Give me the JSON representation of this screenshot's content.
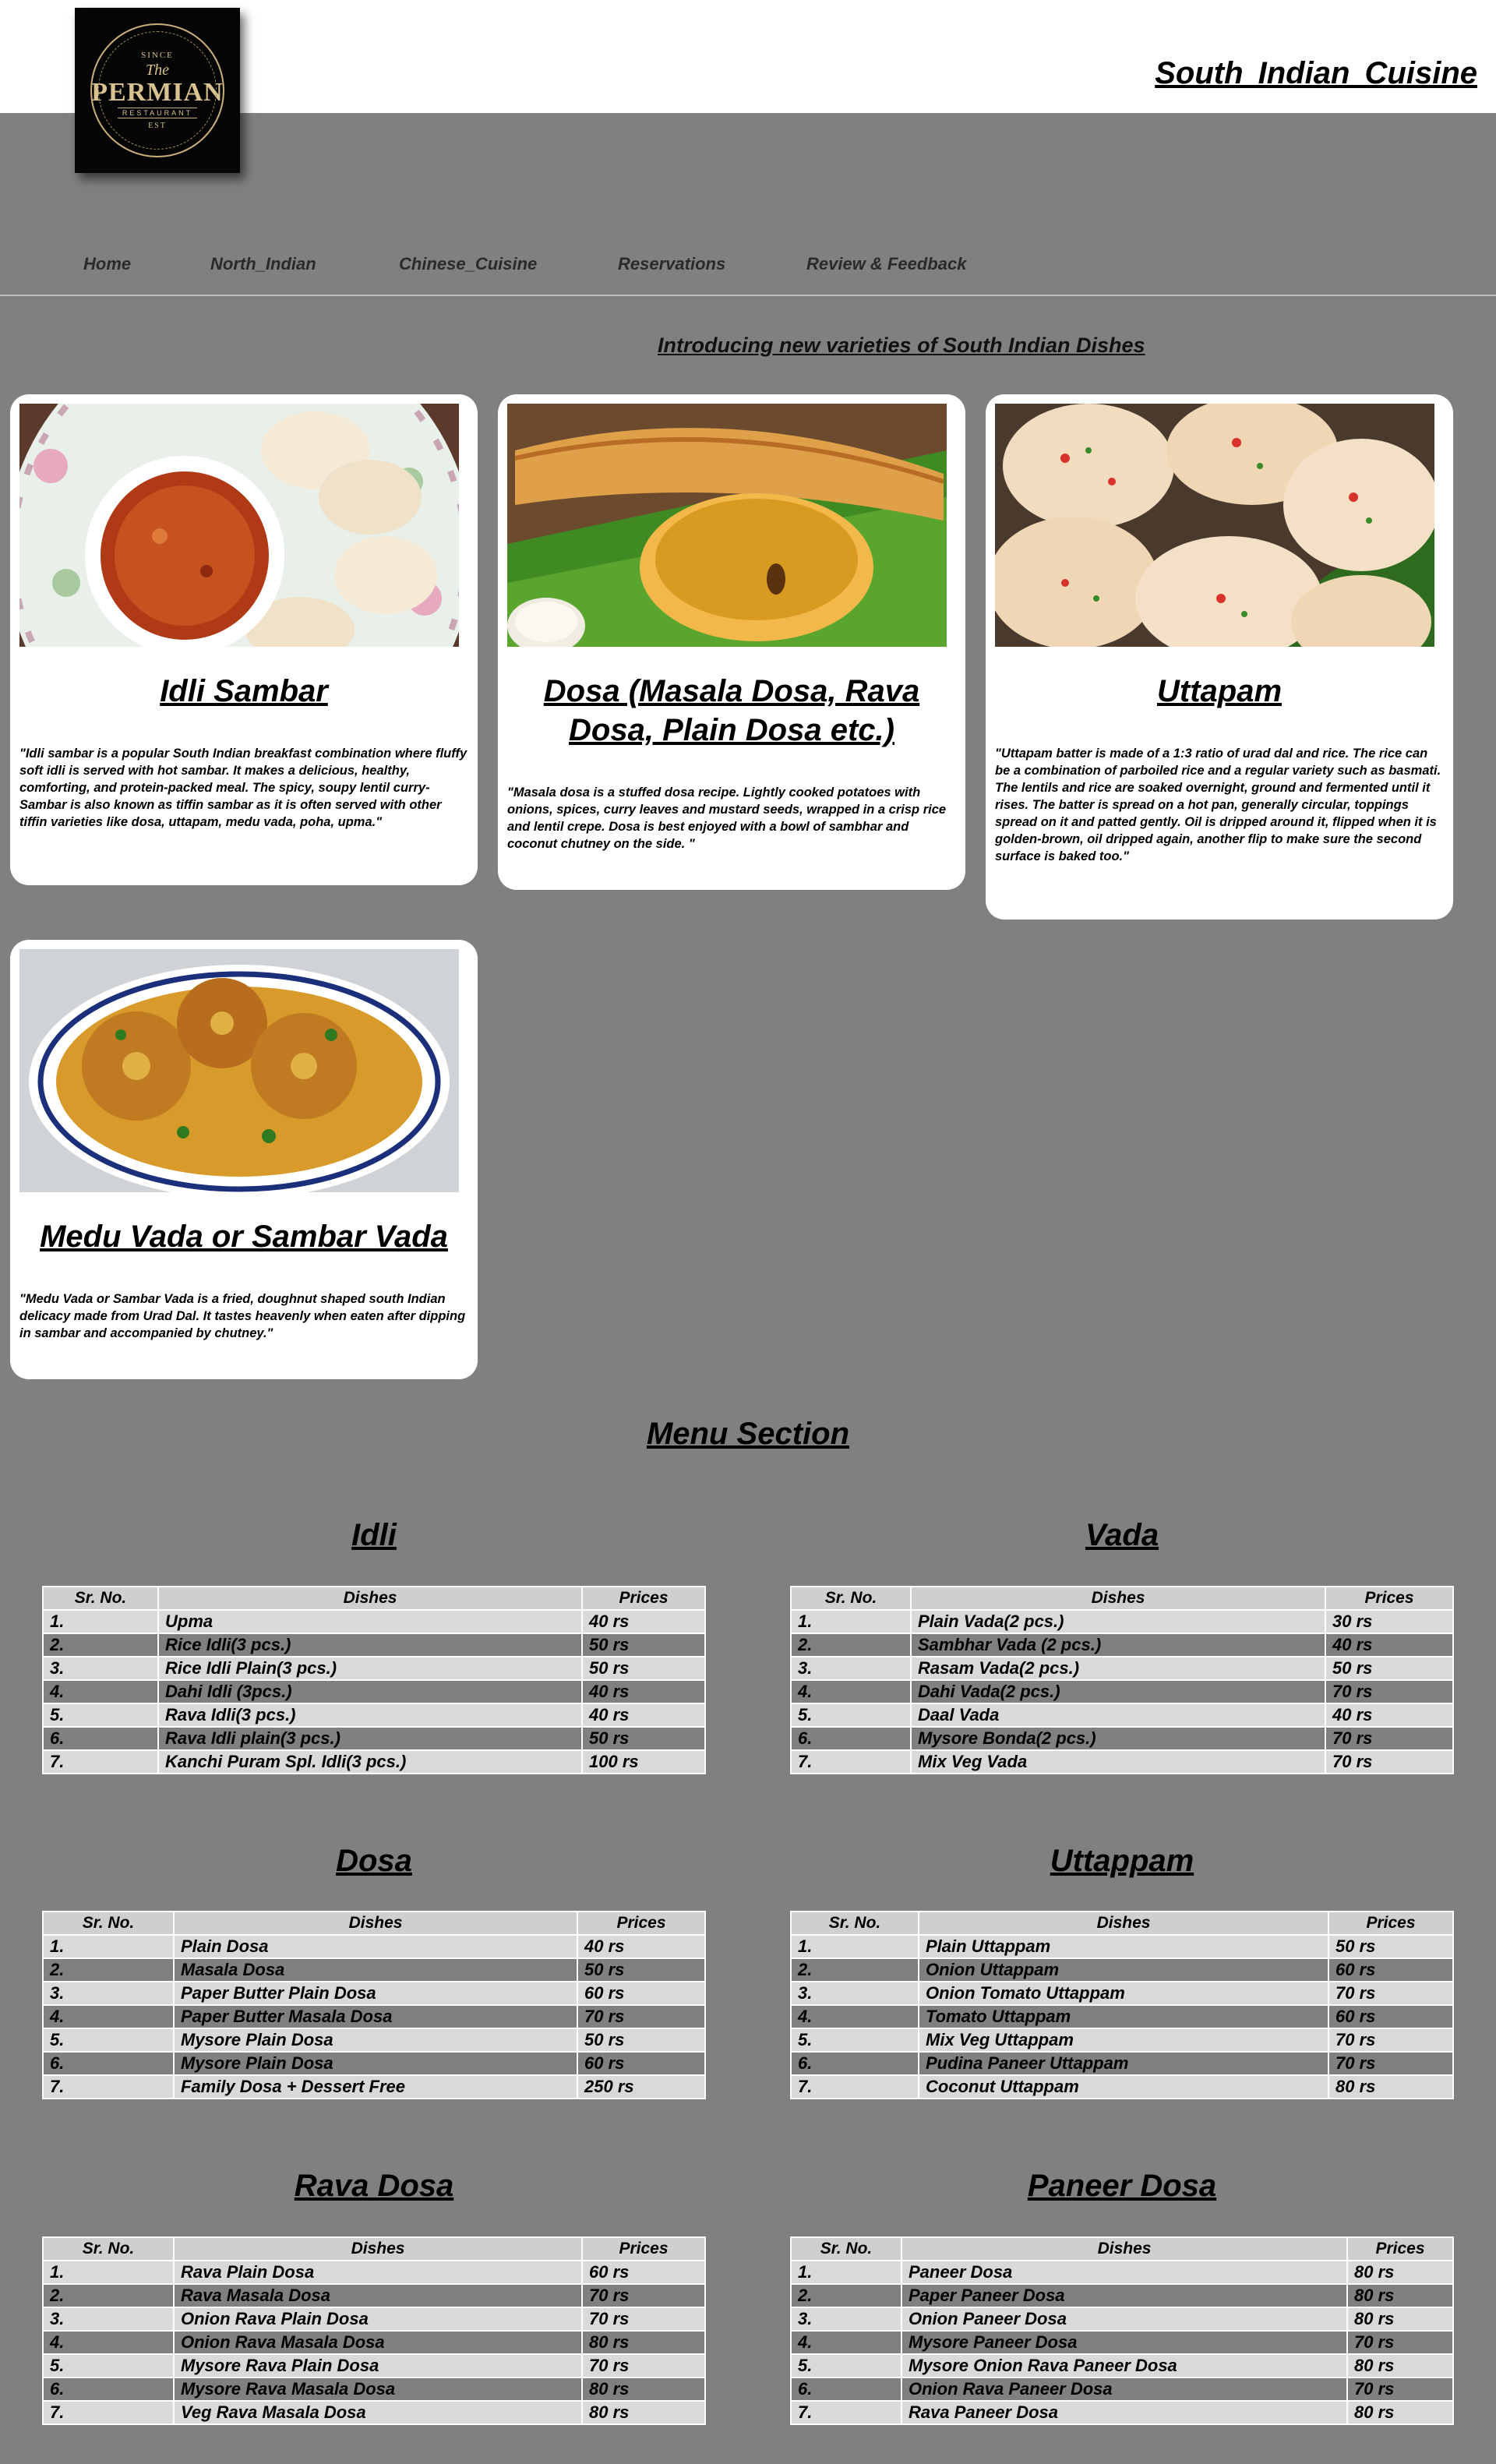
{
  "header": {
    "site_title": "South  Indian  Cuisine",
    "logo": {
      "top": "SINCE",
      "the": "The",
      "main": "PERMIAN",
      "sub": "RESTAURANT",
      "bottom": "EST"
    }
  },
  "nav": [
    {
      "label": "Home"
    },
    {
      "label": "North_Indian"
    },
    {
      "label": "Chinese_Cuisine"
    },
    {
      "label": "Reservations"
    },
    {
      "label": "Review & Feedback"
    }
  ],
  "intro_heading": "Introducing new varieties of South Indian Dishes",
  "cards": [
    {
      "title": "Idli Sambar",
      "image": "idli-sambar-photo",
      "description": "\"Idli sambar is a popular South Indian breakfast combination where fluffy soft idli is served with hot sambar. It makes a delicious, healthy, comforting, and protein-packed meal. The spicy, soupy lentil curry- Sambar is also known as tiffin sambar as it is often served with other tiffin varieties like dosa, uttapam, medu vada, poha, upma.\""
    },
    {
      "title": "Dosa (Masala Dosa, Rava Dosa, Plain Dosa etc.)",
      "image": "dosa-photo",
      "description": "\"Masala dosa is a stuffed dosa recipe. Lightly cooked potatoes with onions, spices, curry leaves and mustard seeds, wrapped in a crisp rice and lentil crepe. Dosa is best enjoyed with a bowl of sambhar and coconut chutney on the side. \""
    },
    {
      "title": "Uttapam",
      "image": "uttapam-photo",
      "description": "\"Uttapam batter is made of a 1:3 ratio of urad dal and rice. The rice can be a combination of parboiled rice and a regular variety such as basmati. The lentils and rice are soaked overnight, ground and fermented until it rises. The batter is spread on a hot pan, generally circular, toppings spread on it and patted gently. Oil is dripped around it, flipped when it is golden-brown, oil dripped again, another flip to make sure the second surface is baked too.\""
    },
    {
      "title": "Medu Vada or Sambar Vada",
      "image": "medu-vada-photo",
      "description": "\"Medu Vada or Sambar Vada is a fried, doughnut shaped south Indian delicacy made from Urad Dal. It tastes heavenly when eaten after dipping in sambar and accompanied by chutney.\""
    }
  ],
  "menu": {
    "title": "Menu Section",
    "headers": {
      "sr": "Sr. No.",
      "dish": "Dishes",
      "price": "Prices"
    },
    "sections": [
      {
        "title": "Idli",
        "rows": [
          [
            "1.",
            "Upma",
            "40 rs"
          ],
          [
            "2.",
            "Rice Idli(3 pcs.)",
            "50 rs"
          ],
          [
            "3.",
            "Rice Idli Plain(3 pcs.)",
            "50 rs"
          ],
          [
            "4.",
            "Dahi Idli (3pcs.)",
            "40 rs"
          ],
          [
            "5.",
            "Rava Idli(3 pcs.)",
            "40 rs"
          ],
          [
            "6.",
            "Rava Idli plain(3 pcs.)",
            "50 rs"
          ],
          [
            "7.",
            "Kanchi Puram Spl. Idli(3 pcs.)",
            "100 rs"
          ]
        ]
      },
      {
        "title": "Vada",
        "rows": [
          [
            "1.",
            "Plain Vada(2 pcs.)",
            "30 rs"
          ],
          [
            "2.",
            "Sambhar Vada (2 pcs.)",
            "40 rs"
          ],
          [
            "3.",
            "Rasam Vada(2 pcs.)",
            "50 rs"
          ],
          [
            "4.",
            "Dahi Vada(2 pcs.)",
            "70 rs"
          ],
          [
            "5.",
            "Daal Vada",
            "40 rs"
          ],
          [
            "6.",
            "Mysore Bonda(2 pcs.)",
            "70 rs"
          ],
          [
            "7.",
            "Mix Veg Vada",
            "70 rs"
          ]
        ]
      },
      {
        "title": "Dosa",
        "rows": [
          [
            "1.",
            "Plain Dosa",
            "40 rs"
          ],
          [
            "2.",
            "Masala Dosa",
            "50 rs"
          ],
          [
            "3.",
            "Paper Butter Plain Dosa",
            "60 rs"
          ],
          [
            "4.",
            "Paper Butter Masala Dosa",
            "70 rs"
          ],
          [
            "5.",
            "Mysore Plain Dosa",
            "50 rs"
          ],
          [
            "6.",
            "Mysore Plain Dosa",
            "60 rs"
          ],
          [
            "7.",
            "Family Dosa + Dessert Free",
            "250 rs"
          ]
        ]
      },
      {
        "title": "Uttappam",
        "rows": [
          [
            "1.",
            "Plain Uttappam",
            "50 rs"
          ],
          [
            "2.",
            "Onion Uttappam",
            "60 rs"
          ],
          [
            "3.",
            "Onion Tomato Uttappam",
            "70 rs"
          ],
          [
            "4.",
            "Tomato Uttappam",
            "60 rs"
          ],
          [
            "5.",
            "Mix Veg Uttappam",
            "70 rs"
          ],
          [
            "6.",
            "Pudina Paneer Uttappam",
            "70 rs"
          ],
          [
            "7.",
            "Coconut Uttappam",
            "80 rs"
          ]
        ]
      },
      {
        "title": "Rava Dosa",
        "rows": [
          [
            "1.",
            "Rava Plain Dosa",
            "60 rs"
          ],
          [
            "2.",
            "Rava Masala Dosa",
            "70 rs"
          ],
          [
            "3.",
            "Onion Rava Plain Dosa",
            "70 rs"
          ],
          [
            "4.",
            "Onion Rava Masala Dosa",
            "80 rs"
          ],
          [
            "5.",
            "Mysore Rava Plain Dosa",
            "70 rs"
          ],
          [
            "6.",
            "Mysore Rava Masala Dosa",
            "80 rs"
          ],
          [
            "7.",
            "Veg Rava Masala Dosa",
            "80 rs"
          ]
        ]
      },
      {
        "title": "Paneer Dosa",
        "rows": [
          [
            "1.",
            "Paneer Dosa",
            "80 rs"
          ],
          [
            "2.",
            "Paper Paneer Dosa",
            "80 rs"
          ],
          [
            "3.",
            "Onion Paneer Dosa",
            "80 rs"
          ],
          [
            "4.",
            "Mysore Paneer Dosa",
            "70 rs"
          ],
          [
            "5.",
            "Mysore Onion Rava Paneer Dosa",
            "80 rs"
          ],
          [
            "6.",
            "Onion Rava Paneer Dosa",
            "70 rs"
          ],
          [
            "7.",
            "Rava Paneer Dosa",
            "80 rs"
          ]
        ]
      }
    ]
  },
  "colors": {
    "page_bg": "#808080",
    "header_bg": "#ffffff",
    "card_bg": "#ffffff",
    "row_light": "#d9d9d9",
    "row_dark": "#808080",
    "nav_text": "#2a2a2a"
  }
}
